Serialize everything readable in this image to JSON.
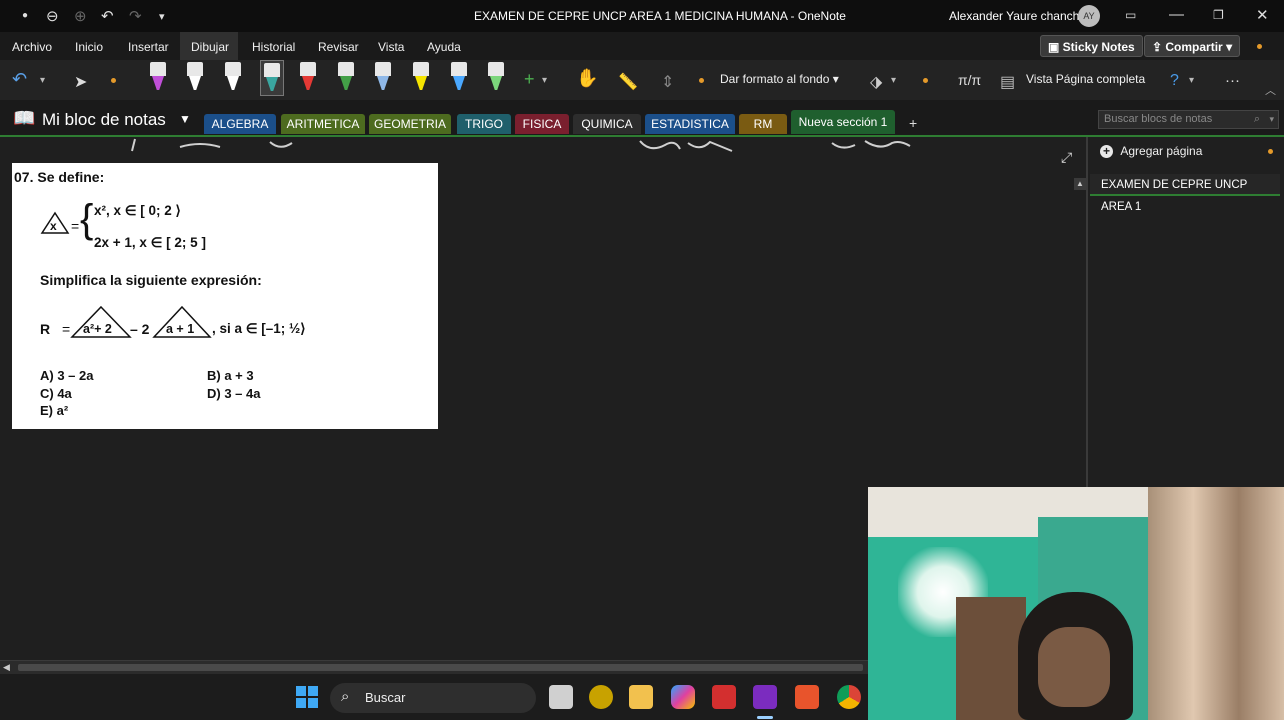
{
  "titlebar": {
    "title": "EXAMEN DE CEPRE UNCP AREA 1 MEDICINA HUMANA  -  OneNote",
    "user_name": "Alexander Yaure chancha",
    "avatar_initials": "AY"
  },
  "menu": {
    "items": [
      "Archivo",
      "Inicio",
      "Insertar",
      "Dibujar",
      "Historial",
      "Revisar",
      "Vista",
      "Ayuda"
    ],
    "active": "Dibujar",
    "sticky_notes": "Sticky Notes",
    "share": "Compartir"
  },
  "ribbon": {
    "format_background": "Dar formato al fondo",
    "full_page_view": "Vista Página completa",
    "pen_colors": [
      "#c04fd8",
      "#ffffff",
      "#ffffff",
      "#3aa6a0",
      "#e53935",
      "#43a047",
      "#8fb8e8",
      "#f5e400",
      "#4aa8ff",
      "#7bd67b"
    ]
  },
  "notebook": {
    "name": "Mi bloc de notas",
    "search_placeholder": "Buscar blocs de notas",
    "sections": [
      {
        "label": "ALGEBRA",
        "color": "#1b4f8a"
      },
      {
        "label": "ARITMETICA",
        "color": "#4d6b1f"
      },
      {
        "label": "GEOMETRIA",
        "color": "#4d6b1f"
      },
      {
        "label": "TRIGO",
        "color": "#1f5f6b"
      },
      {
        "label": "FISICA",
        "color": "#7a1f2e"
      },
      {
        "label": "QUIMICA",
        "color": "#2d2d2d"
      },
      {
        "label": "ESTADISTICA",
        "color": "#1b4f8a"
      },
      {
        "label": "RM",
        "color": "#7a5b12"
      },
      {
        "label": "Nueva sección 1",
        "color": "#1f5f2e"
      }
    ]
  },
  "right_panel": {
    "add_page": "Agregar página",
    "pages": [
      "EXAMEN DE CEPRE UNCP AREA 1"
    ]
  },
  "problem": {
    "heading": "07.  Se define:",
    "case1": "x², x ∈ [ 0; 2 ⟩",
    "case2": "2x + 1,  x ∈ [ 2; 5 ]",
    "triangle_var": "x",
    "instruction": "Simplifica la siguiente expresión:",
    "expr_R": "R",
    "tri1": "a²+ 2",
    "minus2": "– 2",
    "tri2": "a + 1",
    "condition": ",  si a ∈ [–1; ½⟩",
    "options": [
      {
        "label": "A) 3 – 2a"
      },
      {
        "label": "B) a + 3"
      },
      {
        "label": "C) 4a"
      },
      {
        "label": "D) 3 – 4a"
      },
      {
        "label": "E) a²"
      }
    ]
  },
  "taskbar": {
    "search_label": "Buscar"
  }
}
